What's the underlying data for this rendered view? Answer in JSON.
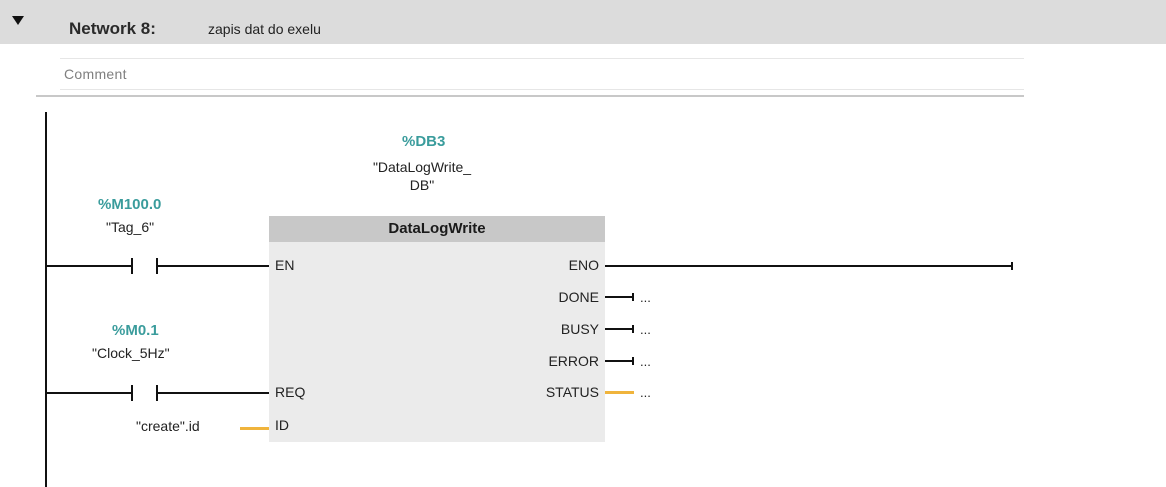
{
  "network": {
    "title": "Network 8:",
    "description": "zapis dat do exelu",
    "comment_placeholder": "Comment"
  },
  "contacts": [
    {
      "address": "%M100.0",
      "tag": "\"Tag_6\""
    },
    {
      "address": "%M0.1",
      "tag": "\"Clock_5Hz\""
    }
  ],
  "block": {
    "instance_address": "%DB3",
    "instance_name": "\"DataLogWrite_\nDB\"",
    "name": "DataLogWrite",
    "inputs": [
      "EN",
      "REQ",
      "ID"
    ],
    "outputs": [
      "ENO",
      "DONE",
      "BUSY",
      "ERROR",
      "STATUS"
    ],
    "id_operand": "\"create\".id",
    "placeholder": "..."
  },
  "colors": {
    "address": "#3a9c9c",
    "header_bg": "#dcdcdc",
    "block_bg": "#ebebeb",
    "block_title_bg": "#c8c8c8",
    "data_wire": "#f0b43c"
  }
}
